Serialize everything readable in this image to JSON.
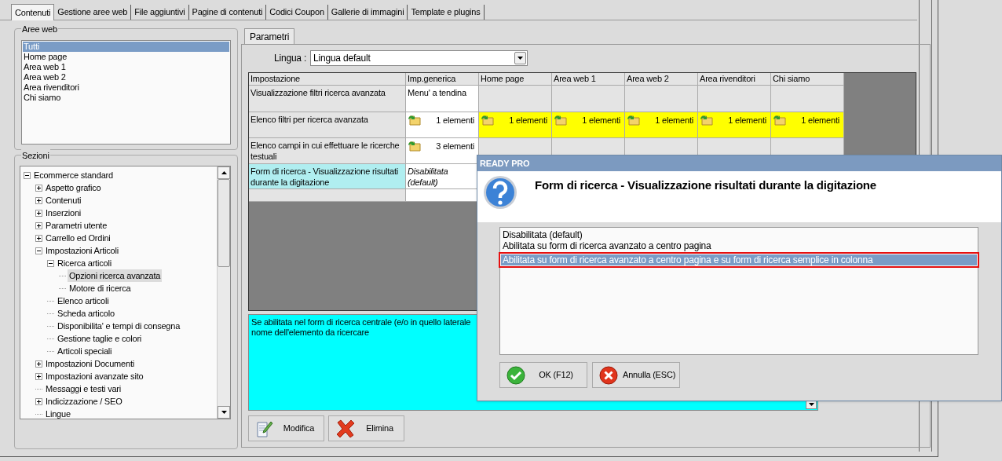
{
  "tabs": [
    {
      "label": "Contenuti",
      "selected": true
    },
    {
      "label": "Gestione aree web",
      "selected": false
    },
    {
      "label": "File aggiuntivi",
      "selected": false
    },
    {
      "label": "Pagine di contenuti",
      "selected": false
    },
    {
      "label": "Codici Coupon",
      "selected": false
    },
    {
      "label": "Gallerie di immagini",
      "selected": false
    },
    {
      "label": "Template e plugins",
      "selected": false
    }
  ],
  "aree_web": {
    "title": "Aree web",
    "items": [
      {
        "label": "Tutti",
        "selected": true
      },
      {
        "label": "Home page",
        "selected": false
      },
      {
        "label": "Area web 1",
        "selected": false
      },
      {
        "label": "Area web 2",
        "selected": false
      },
      {
        "label": "Area rivenditori",
        "selected": false
      },
      {
        "label": "Chi siamo",
        "selected": false
      }
    ]
  },
  "sezioni": {
    "title": "Sezioni",
    "tree": [
      {
        "label": "Ecommerce standard",
        "expanded": true,
        "selected": false,
        "children": [
          {
            "label": "Aspetto grafico",
            "expanded": false,
            "selected": false
          },
          {
            "label": "Contenuti",
            "expanded": false,
            "selected": false
          },
          {
            "label": "Inserzioni",
            "expanded": false,
            "selected": false
          },
          {
            "label": "Parametri utente",
            "expanded": false,
            "selected": false
          },
          {
            "label": "Carrello ed Ordini",
            "expanded": false,
            "selected": false
          },
          {
            "label": "Impostazioni Articoli",
            "expanded": true,
            "selected": false,
            "children": [
              {
                "label": "Ricerca articoli",
                "expanded": true,
                "selected": false,
                "children": [
                  {
                    "label": "Opzioni ricerca avanzata",
                    "selected": true
                  },
                  {
                    "label": "Motore di ricerca",
                    "selected": false
                  }
                ]
              },
              {
                "label": "Elenco articoli",
                "selected": false
              },
              {
                "label": "Scheda articolo",
                "selected": false
              },
              {
                "label": "Disponibilita' e tempi di consegna",
                "selected": false
              },
              {
                "label": "Gestione taglie e colori",
                "selected": false
              },
              {
                "label": "Articoli speciali",
                "selected": false
              }
            ]
          },
          {
            "label": "Impostazioni Documenti",
            "expanded": false,
            "selected": false
          },
          {
            "label": "Impostazioni avanzate sito",
            "expanded": false,
            "selected": false
          },
          {
            "label": "Messaggi e testi vari",
            "selected": false
          },
          {
            "label": "Indicizzazione / SEO",
            "expanded": false,
            "selected": false
          },
          {
            "label": "Lingue",
            "selected": false
          }
        ]
      }
    ]
  },
  "parametri": {
    "tab": {
      "label": "Parametri",
      "selected": true
    },
    "lingua_label": "Lingua :",
    "lingua_value": "Lingua default",
    "columns": [
      "Impostazione",
      "Imp.generica",
      "Home page",
      "Area web 1",
      "Area web 2",
      "Area rivenditori",
      "Chi siamo"
    ],
    "rows": [
      {
        "selected": false,
        "cells": [
          {
            "kind": "label",
            "text": "Visualizzazione filtri ricerca avanzata"
          },
          {
            "kind": "text",
            "text": "Menu' a tendina"
          },
          {
            "kind": "empty"
          },
          {
            "kind": "empty"
          },
          {
            "kind": "empty"
          },
          {
            "kind": "empty"
          },
          {
            "kind": "empty"
          }
        ]
      },
      {
        "selected": false,
        "cells": [
          {
            "kind": "label",
            "text": "Elenco filtri per ricerca avanzata"
          },
          {
            "kind": "count",
            "text": "1 elementi",
            "highlighted": false
          },
          {
            "kind": "count",
            "text": "1 elementi",
            "highlighted": true
          },
          {
            "kind": "count",
            "text": "1 elementi",
            "highlighted": true
          },
          {
            "kind": "count",
            "text": "1 elementi",
            "highlighted": true
          },
          {
            "kind": "count",
            "text": "1 elementi",
            "highlighted": true
          },
          {
            "kind": "count",
            "text": "1 elementi",
            "highlighted": true
          }
        ]
      },
      {
        "selected": false,
        "cells": [
          {
            "kind": "label",
            "text": "Elenco campi in cui effettuare le ricerche testuali"
          },
          {
            "kind": "count",
            "text": "3 elementi",
            "highlighted": false
          },
          {
            "kind": "empty"
          },
          {
            "kind": "empty"
          },
          {
            "kind": "empty"
          },
          {
            "kind": "empty"
          },
          {
            "kind": "empty"
          }
        ]
      },
      {
        "selected": true,
        "cells": [
          {
            "kind": "label",
            "text": "Form di ricerca - Visualizzazione risultati durante la digitazione"
          },
          {
            "kind": "default",
            "text": "Disabilitata (default)"
          }
        ]
      }
    ],
    "description": [
      "Se abilitata nel form di ricerca centrale (e/o in quello laterale",
      "nome dell'elemento da ricercare"
    ],
    "buttons": [
      {
        "kind": "edit",
        "label": "Modifica"
      },
      {
        "kind": "delete",
        "label": "Elimina"
      }
    ]
  },
  "dialog": {
    "title": "READY PRO",
    "heading": "Form di ricerca - Visualizzazione risultati durante la digitazione",
    "options": [
      {
        "label": "Disabilitata (default)",
        "selected": false
      },
      {
        "label": "Abilitata su form di ricerca avanzato a centro pagina",
        "selected": false
      },
      {
        "label": "Abilitata su form di ricerca avanzato a centro pagina e su form di ricerca semplice in colonna",
        "selected": true
      }
    ],
    "buttons": [
      {
        "kind": "ok",
        "label": "OK (F12)"
      },
      {
        "kind": "cancel",
        "label": "Annulla (ESC)"
      }
    ]
  }
}
